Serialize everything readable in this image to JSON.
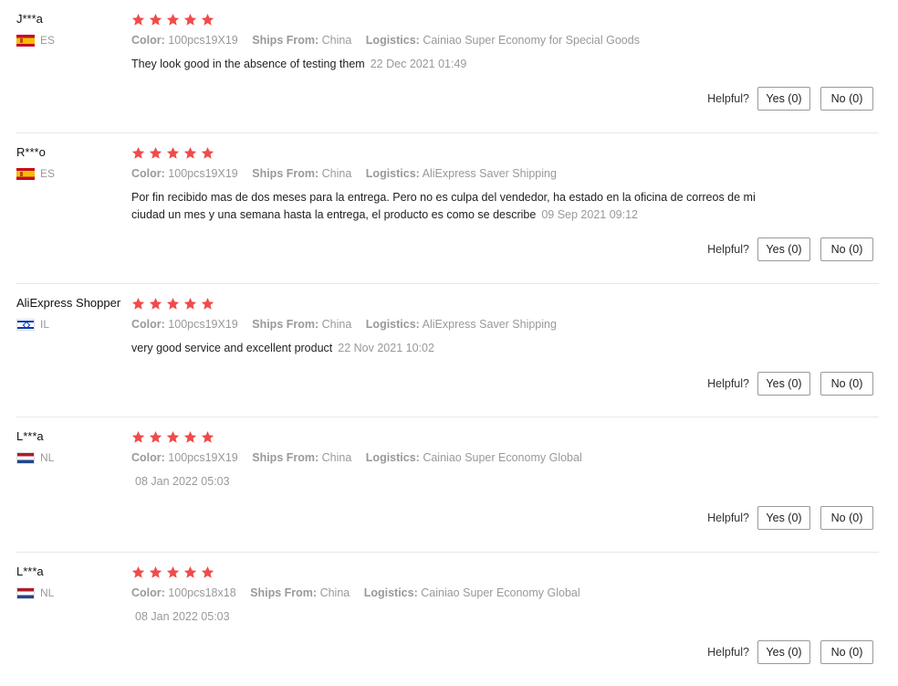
{
  "labels": {
    "color": "Color:",
    "ships_from": "Ships From:",
    "logistics": "Logistics:",
    "helpful": "Helpful?"
  },
  "star_color": "#f04b4b",
  "reviews": [
    {
      "user": "J***a",
      "country": "ES",
      "flag": "spain-flag-icon",
      "rating": 5,
      "color": "100pcs19X19",
      "ships_from": "China",
      "logistics": "Cainiao Super Economy for Special Goods",
      "text": "They look good in the absence of testing them",
      "date": "22 Dec 2021 01:49",
      "yes": "Yes (0)",
      "no": "No (0)"
    },
    {
      "user": "R***o",
      "country": "ES",
      "flag": "spain-flag-icon",
      "rating": 5,
      "color": "100pcs19X19",
      "ships_from": "China",
      "logistics": "AliExpress Saver Shipping",
      "text": "Por fin recibido mas de dos meses para la entrega. Pero no es culpa del vendedor, ha estado en la oficina de correos de mi ciudad un mes y una semana hasta la entrega, el producto es como se describe",
      "date": "09 Sep 2021 09:12",
      "yes": "Yes (0)",
      "no": "No (0)"
    },
    {
      "user": "AliExpress Shopper",
      "country": "IL",
      "flag": "israel-flag-icon",
      "rating": 5,
      "color": "100pcs19X19",
      "ships_from": "China",
      "logistics": "AliExpress Saver Shipping",
      "text": "very good service and excellent product",
      "date": "22 Nov 2021 10:02",
      "yes": "Yes (0)",
      "no": "No (0)"
    },
    {
      "user": "L***a",
      "country": "NL",
      "flag": "netherlands-flag-icon",
      "rating": 5,
      "color": "100pcs19X19",
      "ships_from": "China",
      "logistics": "Cainiao Super Economy Global",
      "text": "",
      "date": "08 Jan 2022 05:03",
      "yes": "Yes (0)",
      "no": "No (0)"
    },
    {
      "user": "L***a",
      "country": "NL",
      "flag": "netherlands-flag-icon",
      "rating": 5,
      "color": "100pcs18x18",
      "ships_from": "China",
      "logistics": "Cainiao Super Economy Global",
      "text": "",
      "date": "08 Jan 2022 05:03",
      "yes": "Yes (0)",
      "no": "No (0)"
    }
  ]
}
